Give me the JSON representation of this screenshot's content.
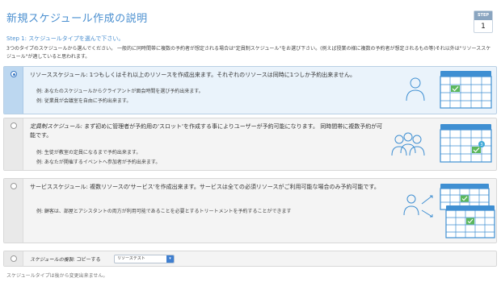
{
  "header": {
    "title": "新規スケジュール作成の説明",
    "step_label": "STEP",
    "step_number": "1"
  },
  "step_heading": "Step 1: スケジュールタイプを選んで下さい。",
  "intro": "3つのタイプのスケジュールから選んでください。 一般的に同時間帯に複数の予約者が想定される場合は\"定員制スケジュール\"をお選び下さい。(例えば授業の様に複数の予約者が想定されるもの等)それ以外は\"リソーススケジュール\"が適していると思われます。",
  "options": [
    {
      "title": "リソーススケジュール: 1つもしくはそれ以上のリソースを作成出来ます。それぞれのリソースは同時に1つしか予約出来ません。",
      "selected": true,
      "bullets": [
        "例: あなたのスケジュールからクライアントが面会時間を選び予約出来ます。",
        "例: 従業員が会議室を自由に予約出来ます。"
      ]
    },
    {
      "title_em": "定員制スケジュール:",
      "title_rest": " まず初めに管理者が予約用の'スロット'を作成する事によりユーザーが予約可能になります。 同時間帯に複数予約が可能です。",
      "selected": false,
      "badge": "3",
      "bullets": [
        "例: 生徒が教室の定員になるまで予約出来ます。",
        "例: あなたが開催するイベントへ参加者が予約出来ます。"
      ]
    },
    {
      "title": "サービススケジュール: 複数リソースの'サービス'を作成出来ます。サービスは全ての必須リソースがご利用可能な場合のみ予約可能です。",
      "selected": false,
      "bullets": [
        "例: 顧客は、部屋とアシスタントの両方が利用可能であることを必要とするトリートメントを予約することができます"
      ]
    }
  ],
  "copy": {
    "label_em": "スケジュールの複製:",
    "label_rest": " コピーする",
    "select_value": "リソーステスト"
  },
  "footnote": "スケジュールタイプは後から変更出来ません。",
  "colors": {
    "accent": "#4a8fd0",
    "calendar": "#3f8fd2",
    "check": "#5cb85c",
    "badge": "#3fa9d8"
  }
}
